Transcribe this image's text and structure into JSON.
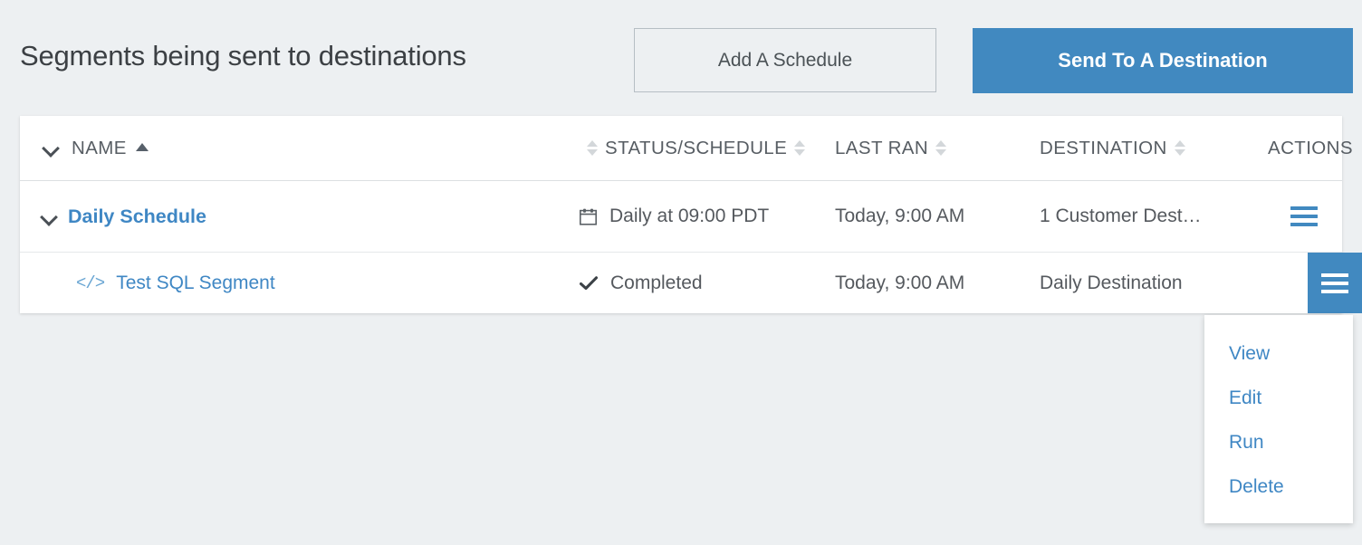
{
  "header": {
    "title": "Segments being sent to destinations",
    "add_schedule_label": "Add A Schedule",
    "send_destination_label": "Send To A Destination"
  },
  "colors": {
    "accent": "#4189c0",
    "link": "#3f87c4",
    "page_background": "#edf0f2",
    "table_background": "#ffffff",
    "text": "#55595e"
  },
  "table": {
    "columns": [
      {
        "key": "name",
        "label": "NAME",
        "sort": "asc",
        "expander": "chevron-down-icon"
      },
      {
        "key": "status",
        "label": "STATUS/SCHEDULE",
        "sort": "none"
      },
      {
        "key": "last_ran",
        "label": "LAST RAN",
        "sort": "none"
      },
      {
        "key": "destination",
        "label": "DESTINATION",
        "sort": "none"
      },
      {
        "key": "actions",
        "label": "ACTIONS",
        "sort": null
      }
    ],
    "rows": [
      {
        "level": "parent",
        "expander_icon": "chevron-down-icon",
        "name": "Daily Schedule",
        "status_icon": "calendar-icon",
        "status": "Daily at 09:00 PDT",
        "last_ran": "Today, 9:00 AM",
        "destination": "1 Customer Dest…",
        "actions_icon": "hamburger-menu-icon",
        "actions_active": false
      },
      {
        "level": "child",
        "expander_icon": "code-icon",
        "name": "Test SQL Segment",
        "status_icon": "check-icon",
        "status": "Completed",
        "last_ran": "Today, 9:00 AM",
        "destination": "Daily Destination",
        "actions_icon": "hamburger-menu-icon",
        "actions_active": true
      }
    ]
  },
  "actions_menu": {
    "visible": true,
    "items": [
      {
        "label": "View"
      },
      {
        "label": "Edit"
      },
      {
        "label": "Run"
      },
      {
        "label": "Delete"
      }
    ]
  }
}
